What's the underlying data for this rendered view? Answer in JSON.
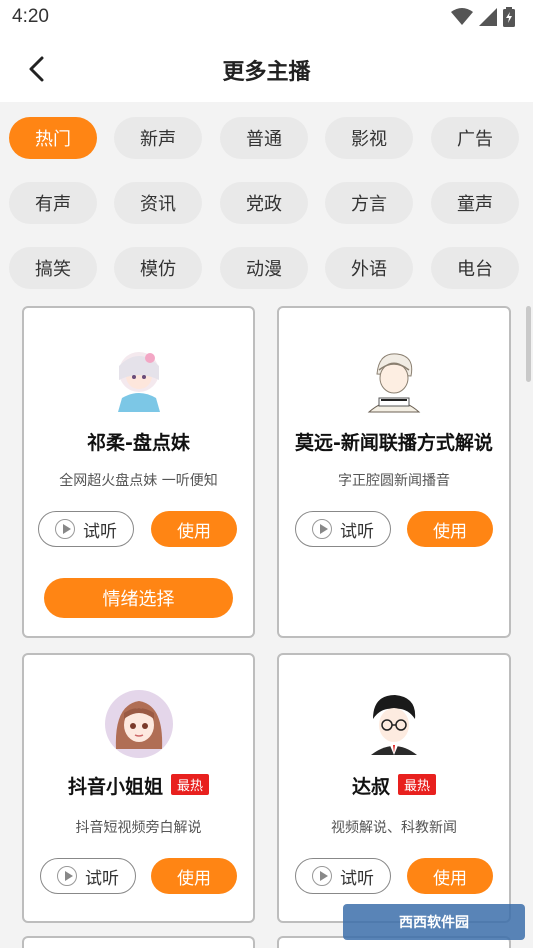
{
  "status": {
    "time": "4:20"
  },
  "header": {
    "title": "更多主播"
  },
  "chips": [
    "热门",
    "新声",
    "普通",
    "影视",
    "广告",
    "有声",
    "资讯",
    "党政",
    "方言",
    "童声",
    "搞笑",
    "模仿",
    "动漫",
    "外语",
    "电台"
  ],
  "cards": [
    {
      "name": "祁柔-盘点妹",
      "desc": "全网超火盘点妹 一听便知",
      "listen": "试听",
      "use": "使用",
      "mood": "情绪选择"
    },
    {
      "name": "莫远-新闻联播方式解说",
      "desc": "字正腔圆新闻播音",
      "listen": "试听",
      "use": "使用"
    },
    {
      "name": "抖音小姐姐",
      "badge": "最热",
      "desc": "抖音短视频旁白解说",
      "listen": "试听",
      "use": "使用"
    },
    {
      "name": "达叔",
      "badge": "最热",
      "desc": "视频解说、科教新闻",
      "listen": "试听",
      "use": "使用"
    }
  ],
  "watermark": "西西软件园"
}
